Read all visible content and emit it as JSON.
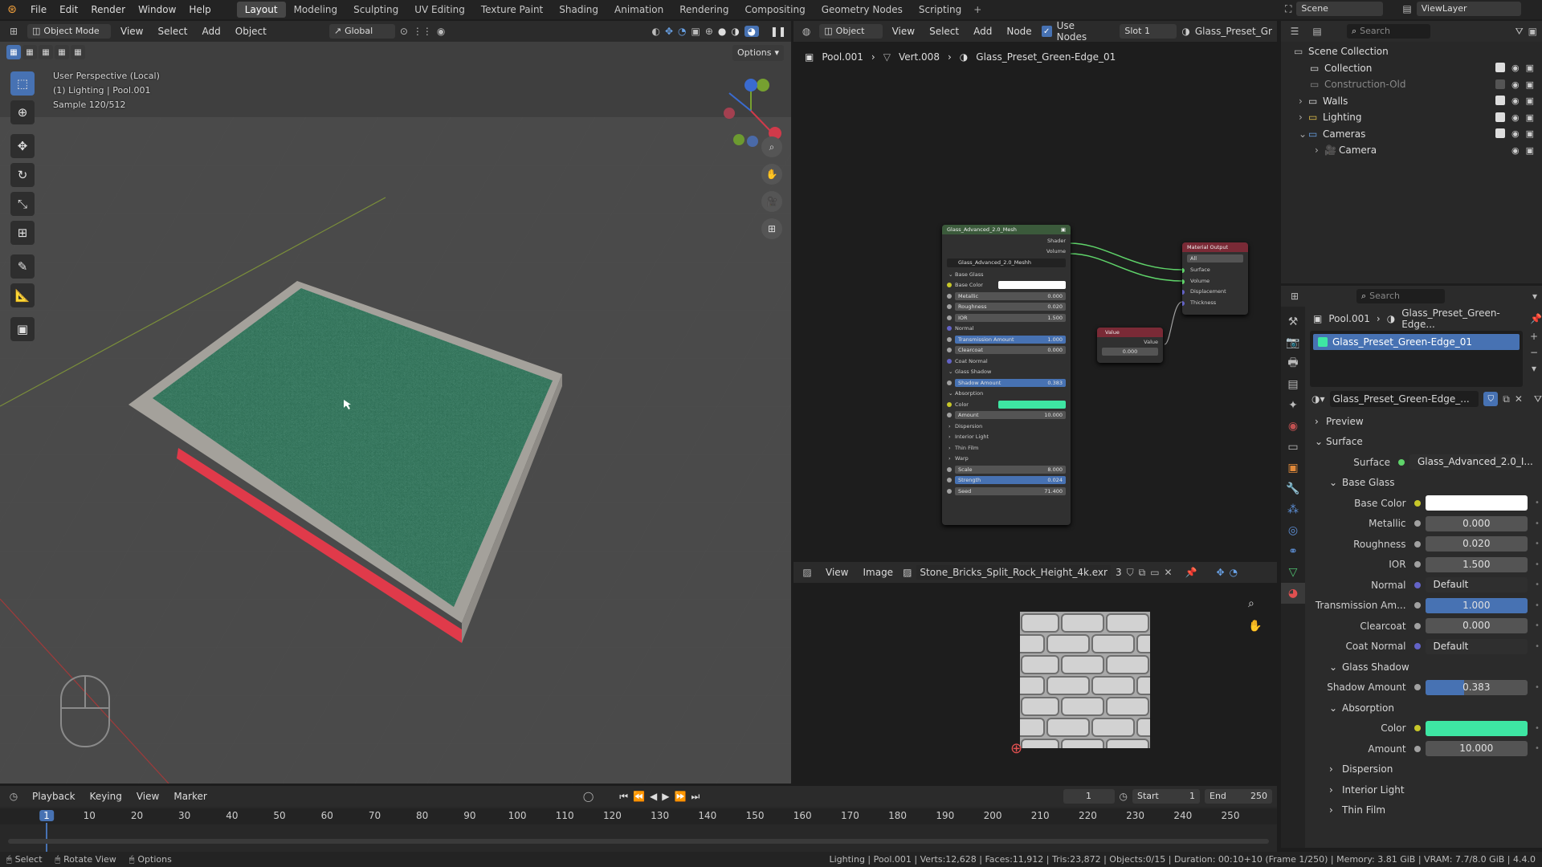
{
  "menu": {
    "items": [
      "File",
      "Edit",
      "Render",
      "Window",
      "Help"
    ]
  },
  "workspaces": {
    "tabs": [
      "Layout",
      "Modeling",
      "Sculpting",
      "UV Editing",
      "Texture Paint",
      "Shading",
      "Animation",
      "Rendering",
      "Compositing",
      "Geometry Nodes",
      "Scripting"
    ],
    "active": "Layout"
  },
  "topbar": {
    "scene": "Scene",
    "view_layer": "ViewLayer"
  },
  "viewport": {
    "mode": "Object Mode",
    "menus": [
      "View",
      "Select",
      "Add",
      "Object"
    ],
    "transform": "Global",
    "options": "Options",
    "overlay": [
      "User Perspective (Local)",
      "(1) Lighting | Pool.001",
      "Sample 120/512"
    ],
    "colors": {
      "water": "#2e6e55",
      "rim": "#a4a19b",
      "side": "#e03a4a"
    }
  },
  "node_editor": {
    "type": "Object",
    "menus": [
      "View",
      "Select",
      "Add",
      "Node"
    ],
    "use_nodes": "Use Nodes",
    "slot": "Slot 1",
    "material": "Glass_Preset_Gr",
    "breadcrumb": [
      "Pool.001",
      "Vert.008",
      "Glass_Preset_Green-Edge_01"
    ],
    "group": {
      "title": "Glass_Advanced_2.0_Mesh",
      "outputs": [
        "Shader",
        "Volume"
      ],
      "datablock": "Glass_Advanced_2.0_Meshh",
      "rows": [
        {
          "type": "header",
          "label": "Base Glass"
        },
        {
          "type": "color",
          "label": "Base Color",
          "color": "#ffffff"
        },
        {
          "type": "field",
          "label": "Metallic",
          "value": "0.000"
        },
        {
          "type": "field",
          "label": "Roughness",
          "value": "0.020"
        },
        {
          "type": "field",
          "label": "IOR",
          "value": "1.500"
        },
        {
          "type": "label",
          "label": "Normal"
        },
        {
          "type": "field",
          "label": "Transmission Amount",
          "value": "1.000",
          "hl": true
        },
        {
          "type": "field",
          "label": "Clearcoat",
          "value": "0.000"
        },
        {
          "type": "label",
          "label": "Coat Normal"
        },
        {
          "type": "header",
          "label": "Glass Shadow"
        },
        {
          "type": "field",
          "label": "Shadow Amount",
          "value": "0.383",
          "hl": true
        },
        {
          "type": "header",
          "label": "Absorption"
        },
        {
          "type": "color",
          "label": "Color",
          "color": "#3ee6a3"
        },
        {
          "type": "field",
          "label": "Amount",
          "value": "10.000"
        },
        {
          "type": "sub",
          "label": "Dispersion"
        },
        {
          "type": "sub",
          "label": "Interior Light"
        },
        {
          "type": "sub",
          "label": "Thin Film"
        },
        {
          "type": "sub",
          "label": "Warp"
        },
        {
          "type": "field",
          "label": "Scale",
          "value": "8.000"
        },
        {
          "type": "field",
          "label": "Strength",
          "value": "0.024",
          "hl": true
        },
        {
          "type": "field",
          "label": "Seed",
          "value": "71.400"
        }
      ]
    },
    "material_output": {
      "title": "Material Output",
      "target": "All",
      "inputs": [
        "Surface",
        "Volume",
        "Displacement",
        "Thickness"
      ]
    },
    "value_node": {
      "title": "Value",
      "output": "Value",
      "value": "0.000"
    }
  },
  "image_editor": {
    "menus": [
      "View",
      "Image"
    ],
    "image": "Stone_Bricks_Split_Rock_Height_4k.exr",
    "users": "3"
  },
  "outliner": {
    "search": "Search",
    "items": [
      {
        "label": "Scene Collection",
        "indent": 0
      },
      {
        "label": "Collection",
        "indent": 1
      },
      {
        "label": "Construction-Old",
        "indent": 1
      },
      {
        "label": "Walls",
        "indent": 1
      },
      {
        "label": "Lighting",
        "indent": 1
      },
      {
        "label": "Cameras",
        "indent": 1
      },
      {
        "label": "Camera",
        "indent": 2
      }
    ]
  },
  "properties": {
    "search": "Search",
    "breadcrumb": [
      "Pool.001",
      "Glass_Preset_Green-Edge..."
    ],
    "slot": "Glass_Preset_Green-Edge_01",
    "material": "Glass_Preset_Green-Edge_...",
    "preview": "Preview",
    "surface_panel": "Surface",
    "surface_label": "Surface",
    "surface_value": "Glass_Advanced_2.0_I...",
    "rows": [
      {
        "type": "header",
        "label": "Base Glass"
      },
      {
        "type": "color",
        "label": "Base Color",
        "color": "#ffffff"
      },
      {
        "type": "field",
        "label": "Metallic",
        "value": "0.000"
      },
      {
        "type": "field",
        "label": "Roughness",
        "value": "0.020"
      },
      {
        "type": "field",
        "label": "IOR",
        "value": "1.500"
      },
      {
        "type": "link",
        "label": "Normal",
        "value": "Default"
      },
      {
        "type": "field",
        "label": "Transmission Am...",
        "value": "1.000",
        "fill": 1.0
      },
      {
        "type": "field",
        "label": "Clearcoat",
        "value": "0.000"
      },
      {
        "type": "link",
        "label": "Coat Normal",
        "value": "Default"
      },
      {
        "type": "header",
        "label": "Glass Shadow"
      },
      {
        "type": "field",
        "label": "Shadow Amount",
        "value": "0.383",
        "fill": 0.383
      },
      {
        "type": "header",
        "label": "Absorption"
      },
      {
        "type": "color",
        "label": "Color",
        "color": "#3ee6a3"
      },
      {
        "type": "field",
        "label": "Amount",
        "value": "10.000"
      },
      {
        "type": "closed",
        "label": "Dispersion"
      },
      {
        "type": "closed",
        "label": "Interior Light"
      },
      {
        "type": "closed",
        "label": "Thin Film"
      }
    ]
  },
  "timeline": {
    "menus": [
      "Playback",
      "Keying",
      "View",
      "Marker"
    ],
    "current_frame": "1",
    "start_label": "Start",
    "start": "1",
    "end_label": "End",
    "end": "250",
    "ticks": [
      "1",
      "10",
      "20",
      "30",
      "40",
      "50",
      "60",
      "70",
      "80",
      "90",
      "100",
      "110",
      "120",
      "130",
      "140",
      "150",
      "160",
      "170",
      "180",
      "190",
      "200",
      "210",
      "220",
      "230",
      "240",
      "250"
    ]
  },
  "statusbar": {
    "left": [
      "Select",
      "Rotate View",
      "Options"
    ],
    "right": "Lighting | Pool.001 | Verts:12,628 | Faces:11,912 | Tris:23,872 | Objects:0/15 | Duration: 00:10+10 (Frame 1/250) | Memory: 3.81 GiB | VRAM: 7.7/8.0 GiB | 4.4.0"
  }
}
